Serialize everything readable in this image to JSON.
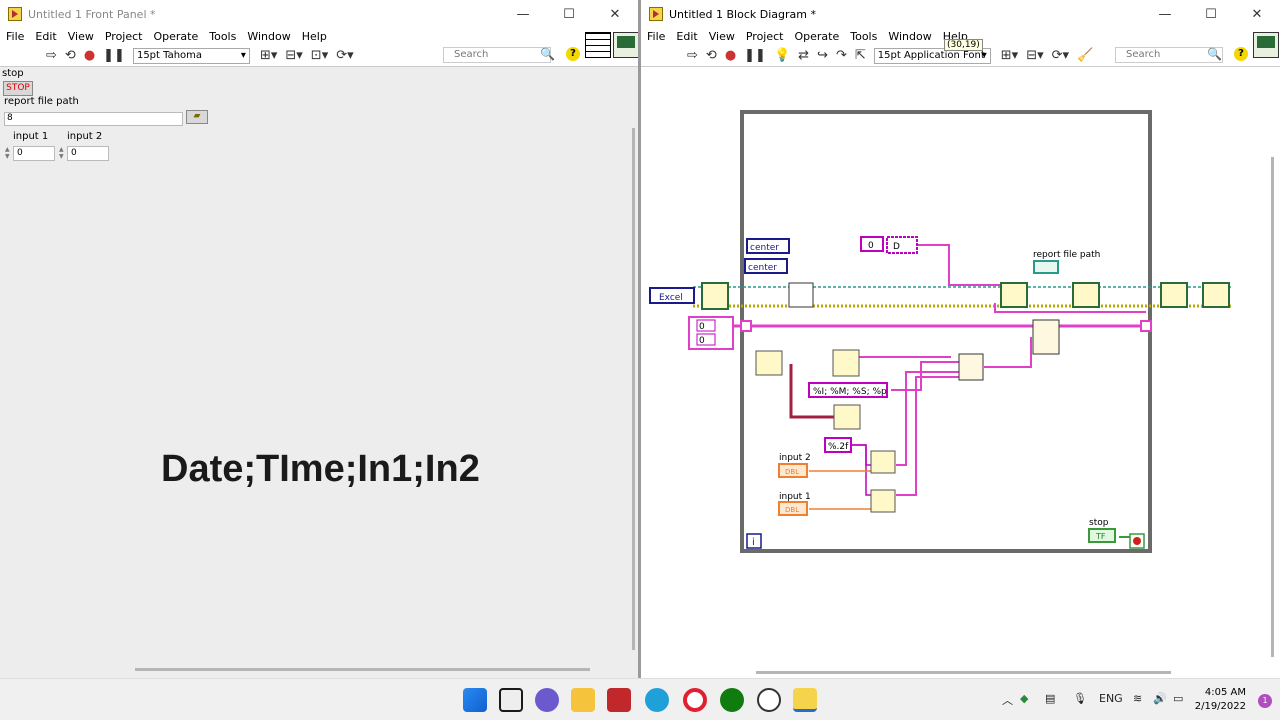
{
  "front_panel": {
    "title": "Untitled 1 Front Panel *",
    "menu": [
      "File",
      "Edit",
      "View",
      "Project",
      "Operate",
      "Tools",
      "Window",
      "Help"
    ],
    "font": "15pt Tahoma",
    "search_placeholder": "Search",
    "stop_label": "stop",
    "stop_button": "STOP",
    "path_label": "report file path",
    "path_value": "",
    "path_prefix": "8",
    "input1_label": "input 1",
    "input1_value": "0",
    "input2_label": "input 2",
    "input2_value": "0",
    "overlay_text": "Date;TIme;In1;In2"
  },
  "block_diagram": {
    "title": "Untitled 1 Block Diagram *",
    "menu": [
      "File",
      "Edit",
      "View",
      "Project",
      "Operate",
      "Tools",
      "Window",
      "Help"
    ],
    "font": "15pt Application Font",
    "coord_tip": "(30,19)",
    "search_placeholder": "Search",
    "excel_label": "Excel",
    "center1": "center",
    "center2": "center",
    "const0a": "0",
    "const_d": "D",
    "report_path_label": "report file path",
    "array0a": "0",
    "array0b": "0",
    "time_format": "%I; %M; %S; %p",
    "num_format": "%.2f",
    "input2_label": "input 2",
    "input1_label": "input 1",
    "dbl": "DBL",
    "stop_label": "stop",
    "tf": "TF",
    "loop_index": "i"
  },
  "taskbar": {
    "lang": "ENG",
    "time": "4:05 AM",
    "date": "2/19/2022",
    "notif_count": "1"
  },
  "colors": {
    "pink_wire": "#e040c8",
    "string_border": "#c000c0",
    "enum_blue": "#1a1a8a",
    "dbl_orange": "#f08030",
    "bool_green": "#3a9a3a",
    "teal_wire": "#2a9a8a",
    "yellow_wire": "#b8a800"
  }
}
